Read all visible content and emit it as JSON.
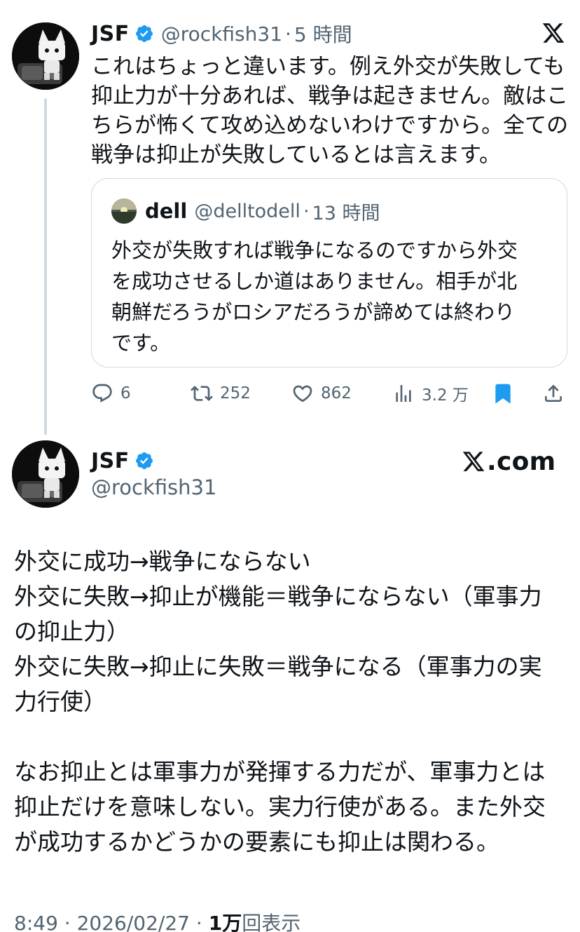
{
  "tweet": {
    "author": {
      "name": "JSF",
      "handle": "@rockfish31",
      "verified": true
    },
    "time_ago": "5 時間",
    "dot": "·",
    "text_lines": [
      "これはちょっと違います。例え外交が失敗しても",
      "抑止力が十分あれば、戦争は起きません。敵はこ",
      "ちらが怖くて攻め込めないわけですから。全ての",
      "戦争は抑止が失敗しているとは言えます。"
    ]
  },
  "quote": {
    "author": {
      "name": "dell",
      "handle": "@delltodell"
    },
    "time_ago": "13 時間",
    "dot": "·",
    "text_lines": [
      "外交が失敗すれば戦争になるのですから外交",
      "を成功させるしか道はありません。相手が北",
      "朝鮮だろうがロシアだろうが諦めては終わり",
      "です。"
    ]
  },
  "actions": {
    "replies": "6",
    "reposts": "252",
    "likes": "862",
    "views": "3.2 万"
  },
  "main_post": {
    "author": {
      "name": "JSF",
      "handle": "@rockfish31",
      "verified": true
    },
    "brand": ".com",
    "body_lines": [
      "外交に成功→戦争にならない",
      "外交に失敗→抑止が機能＝戦争にならない（軍事力",
      "の抑止力）",
      "外交に失敗→抑止に失敗＝戦争になる（軍事力の実",
      "力行使）",
      "",
      "なお抑止とは軍事力が発揮する力だが、軍事力とは",
      "抑止だけを意味しない。実力行使がある。また外交",
      "が成功するかどうかの要素にも抑止は関わる。"
    ],
    "footer": {
      "time": "8:49",
      "sep": "·",
      "date": "2026/02/27",
      "views_count": "1万",
      "views_label": "回表示"
    }
  },
  "colors": {
    "text": "#0f1419",
    "muted": "#536471",
    "accent": "#1d9bf0",
    "border": "#cfd9de"
  },
  "icons": [
    "x-logo-icon",
    "verified-badge-icon",
    "reply-icon",
    "repost-icon",
    "like-icon",
    "views-icon",
    "bookmark-icon",
    "share-icon"
  ]
}
